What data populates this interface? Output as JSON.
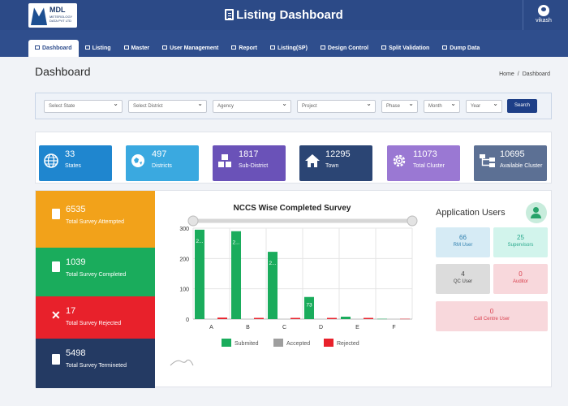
{
  "app": {
    "title": "Listing Dashboard",
    "logo": {
      "main": "MDL",
      "sub": "METEROLOGY DATA PVT LTD"
    },
    "user": "vikash"
  },
  "nav": [
    "Dashboard",
    "Listing",
    "Master",
    "User Management",
    "Report",
    "Listing(SP)",
    "Design Control",
    "Split Validation",
    "Dump Data"
  ],
  "page": {
    "title": "Dashboard",
    "crumb_home": "Home",
    "crumb_sep": "/",
    "crumb_current": "Dashboard"
  },
  "filters": {
    "state": "Select State",
    "district": "Select District",
    "agency": "Agency",
    "project": "Project",
    "phase": "Phase",
    "month": "Month",
    "year": "Year",
    "search": "Search"
  },
  "stats": [
    {
      "value": "33",
      "label": "States",
      "color": "#1f86cf",
      "icon": "globe-icon"
    },
    {
      "value": "497",
      "label": "Districts",
      "color": "#3aa9e0",
      "icon": "map-icon"
    },
    {
      "value": "1817",
      "label": "Sub-District",
      "color": "#6a52b8",
      "icon": "cubes-icon"
    },
    {
      "value": "12295",
      "label": "Town",
      "color": "#2b4574",
      "icon": "home-icon"
    },
    {
      "value": "11073",
      "label": "Total Cluster",
      "color": "#9a78d3",
      "icon": "cog-icon"
    },
    {
      "value": "10695",
      "label": "Available Cluster",
      "color": "#5c7094",
      "icon": "sitemap-icon"
    }
  ],
  "kpis": [
    {
      "value": "6535",
      "label": "Total Survey Attempted",
      "color": "#f2a21a"
    },
    {
      "value": "1039",
      "label": "Total Survey Completed",
      "color": "#1aac5c"
    },
    {
      "value": "17",
      "label": "Total Survey Rejected",
      "color": "#e8212b"
    },
    {
      "value": "5498",
      "label": "Total Survey Termineted",
      "color": "#243a63"
    }
  ],
  "chart_data": {
    "type": "bar",
    "title": "NCCS Wise Completed Survey",
    "categories": [
      "A",
      "B",
      "C",
      "D",
      "E",
      "F"
    ],
    "yticks": [
      0,
      100,
      200,
      300
    ],
    "ylim": [
      0,
      300
    ],
    "series": [
      {
        "name": "Submited",
        "color": "#1aac5c",
        "values": [
          295,
          290,
          222,
          73,
          8,
          1
        ],
        "labels": [
          "2...",
          "2...",
          "2...",
          "73",
          "",
          ""
        ]
      },
      {
        "name": "Accepted",
        "color": "#9e9e9e",
        "values": [
          0,
          0,
          0,
          0,
          0,
          0
        ]
      },
      {
        "name": "Rejected",
        "color": "#e8212b",
        "values": [
          5,
          4,
          4,
          4,
          4,
          1
        ]
      }
    ]
  },
  "users": {
    "title": "Application Users",
    "cards": [
      {
        "value": "66",
        "label": "RM User",
        "bg": "#d6ebf5",
        "fg": "#2f7fae"
      },
      {
        "value": "25",
        "label": "Supervisors",
        "bg": "#d2f4ec",
        "fg": "#27a88c"
      },
      {
        "value": "4",
        "label": "QC User",
        "bg": "#dcdcdc",
        "fg": "#444"
      },
      {
        "value": "0",
        "label": "Auditor",
        "bg": "#f8d8dc",
        "fg": "#d9414f"
      },
      {
        "value": "0",
        "label": "Call Centre User",
        "bg": "#f8d8dc",
        "fg": "#d9414f"
      }
    ]
  }
}
